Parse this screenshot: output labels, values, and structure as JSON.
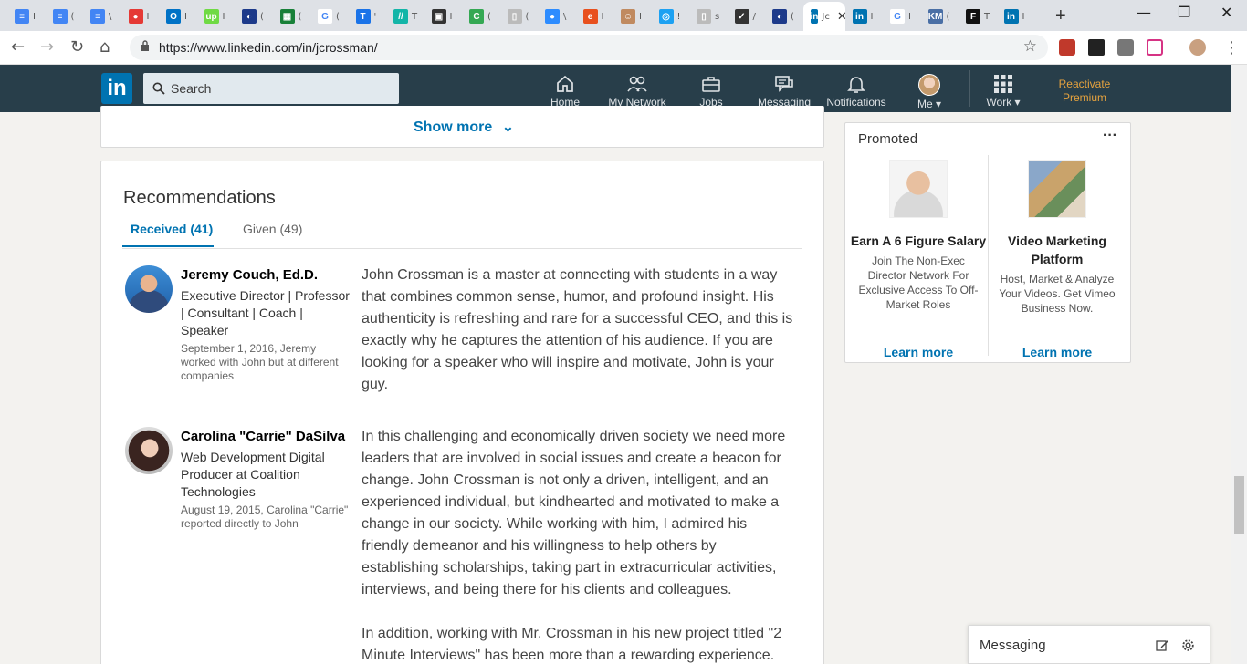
{
  "browser": {
    "tabs": [
      {
        "color": "#4285f4",
        "glyph": "≡",
        "title": "I"
      },
      {
        "color": "#4285f4",
        "glyph": "≡",
        "title": "("
      },
      {
        "color": "#4285f4",
        "glyph": "≡",
        "title": "\\"
      },
      {
        "color": "#e53935",
        "glyph": "●",
        "title": "I"
      },
      {
        "color": "#0072c6",
        "glyph": "O",
        "title": "I"
      },
      {
        "color": "#6fda44",
        "glyph": "up",
        "title": "I"
      },
      {
        "color": "#1d3a8a",
        "glyph": "◐",
        "title": "("
      },
      {
        "color": "#188038",
        "glyph": "▦",
        "title": "("
      },
      {
        "color": "#ffffff",
        "glyph": "G",
        "title": "("
      },
      {
        "color": "#1a73e8",
        "glyph": "T",
        "title": "'"
      },
      {
        "color": "#13b5a8",
        "glyph": "//",
        "title": "T"
      },
      {
        "color": "#333333",
        "glyph": "▣",
        "title": "I"
      },
      {
        "color": "#34a853",
        "glyph": "C",
        "title": "("
      },
      {
        "color": "#bbbbbb",
        "glyph": "▯",
        "title": "("
      },
      {
        "color": "#2d8cff",
        "glyph": "●",
        "title": "\\"
      },
      {
        "color": "#e8501e",
        "glyph": "e",
        "title": "I"
      },
      {
        "color": "#c08a60",
        "glyph": "☺",
        "title": "I"
      },
      {
        "color": "#1da1f2",
        "glyph": "◎",
        "title": "!"
      },
      {
        "color": "#bbbbbb",
        "glyph": "▯",
        "title": "s"
      },
      {
        "color": "#333333",
        "glyph": "✓",
        "title": "/"
      },
      {
        "color": "#1d3a8a",
        "glyph": "◐",
        "title": "("
      },
      {
        "color": "#0073b1",
        "glyph": "in",
        "title": "Jc",
        "active": true
      },
      {
        "color": "#0073b1",
        "glyph": "in",
        "title": "I"
      },
      {
        "color": "#ffffff",
        "glyph": "G",
        "title": "I"
      },
      {
        "color": "#4a6fa5",
        "glyph": "KM",
        "title": "("
      },
      {
        "color": "#111111",
        "glyph": "F",
        "title": "T"
      },
      {
        "color": "#0073b1",
        "glyph": "in",
        "title": "I"
      }
    ],
    "url": "https://www.linkedin.com/in/jcrossman/"
  },
  "linkedin_nav": {
    "search_placeholder": "Search",
    "home": "Home",
    "network": "My Network",
    "jobs": "Jobs",
    "messaging": "Messaging",
    "notifications": "Notifications",
    "me": "Me",
    "work": "Work",
    "premium_line1": "Reactivate",
    "premium_line2": "Premium"
  },
  "show_more": "Show more",
  "recommendations": {
    "title": "Recommendations",
    "tab_received": "Received (41)",
    "tab_given": "Given (49)",
    "items": [
      {
        "name": "Jeremy Couch, Ed.D.",
        "headline": "Executive Director | Professor | Consultant | Coach | Speaker",
        "meta": "September 1, 2016, Jeremy worked with John but at different companies",
        "text": "John Crossman is a master at connecting with students in a way that combines common sense, humor, and profound insight. His authenticity is refreshing and rare for a successful CEO, and this is exactly why he captures the attention of his audience. If you are looking for a speaker who will inspire and motivate, John is your guy."
      },
      {
        "name": "Carolina \"Carrie\" DaSilva",
        "headline": "Web Development Digital Producer at Coalition Technologies",
        "meta": "August 19, 2015, Carolina \"Carrie\" reported directly to John",
        "text": "In this challenging and economically driven society we need more leaders that are involved in social issues and create a beacon for change. John Crossman is not only a driven, intelligent, and an experienced individual, but kindhearted and motivated to make a change in our society. While working with him, I admired his friendly demeanor and his willingness to help others by establishing scholarships, taking part in extracurricular activities, interviews, and being there for his clients and colleagues.",
        "text2": "In addition, working with Mr. Crossman in his new project titled \"2 Minute Interviews\" has been more than a rewarding experience. He"
      }
    ]
  },
  "promoted": {
    "label": "Promoted",
    "menu": "···",
    "ads": [
      {
        "title": "Earn A 6 Figure Salary",
        "desc": "Join The Non-Exec Director Network For Exclusive Access To Off-Market Roles",
        "cta": "Learn more"
      },
      {
        "title": "Video Marketing Platform",
        "desc": "Host, Market & Analyze Your Videos. Get Vimeo Business Now.",
        "cta": "Learn more"
      }
    ]
  },
  "messaging_bar": {
    "label": "Messaging"
  }
}
